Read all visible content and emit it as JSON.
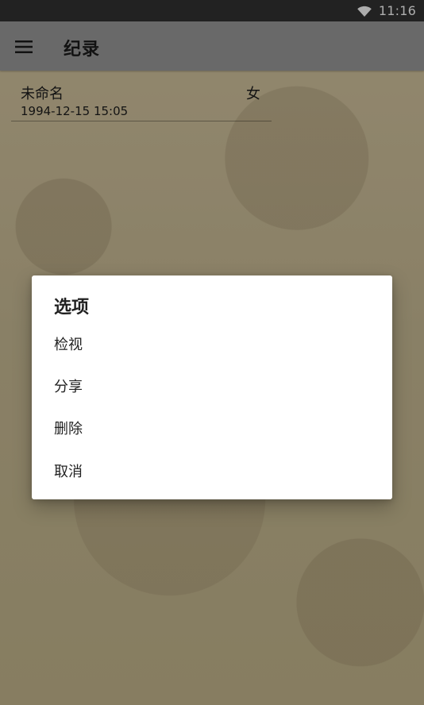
{
  "status_bar": {
    "time": "11:16",
    "wifi_icon": "wifi-icon"
  },
  "toolbar": {
    "title": "纪录",
    "menu_icon": "menu-icon"
  },
  "records": [
    {
      "name": "未命名",
      "gender": "女",
      "datetime": "1994-12-15 15:05"
    }
  ],
  "dialog": {
    "title": "选项",
    "options": [
      {
        "label": "检视"
      },
      {
        "label": "分享"
      },
      {
        "label": "删除"
      },
      {
        "label": "取消"
      }
    ]
  },
  "colors": {
    "status_bar": "#333333",
    "toolbar": "#9b9b9b",
    "dialog_bg": "#ffffff",
    "text_dark": "#202020",
    "paper_bg": "#c7b98f"
  }
}
